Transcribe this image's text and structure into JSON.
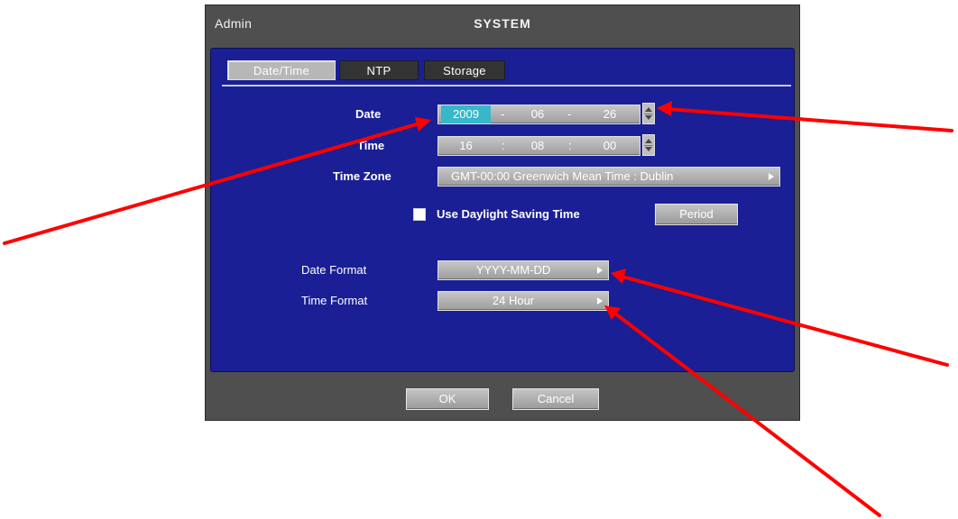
{
  "window": {
    "user": "Admin",
    "title": "SYSTEM"
  },
  "tabs": [
    {
      "label": "Date/Time",
      "active": true
    },
    {
      "label": "NTP",
      "active": false
    },
    {
      "label": "Storage",
      "active": false
    }
  ],
  "form": {
    "date": {
      "label": "Date",
      "year": "2009",
      "month": "06",
      "day": "26",
      "separator": "-"
    },
    "time": {
      "label": "Time",
      "hour": "16",
      "minute": "08",
      "second": "00",
      "separator": ":"
    },
    "time_zone": {
      "label": "Time Zone",
      "value": "GMT-00:00 Greenwich Mean Time : Dublin"
    },
    "daylight": {
      "label": "Use Daylight Saving Time",
      "checked": false,
      "period_button": "Period"
    },
    "date_format": {
      "label": "Date Format",
      "value": "YYYY-MM-DD"
    },
    "time_format": {
      "label": "Time Format",
      "value": "24 Hour"
    }
  },
  "buttons": {
    "ok": "OK",
    "cancel": "Cancel"
  },
  "colors": {
    "panel": "#1a1f95",
    "frame": "#4f4f4f",
    "highlight": "#37b7c9",
    "annotation_arrow": "#ff0000"
  }
}
